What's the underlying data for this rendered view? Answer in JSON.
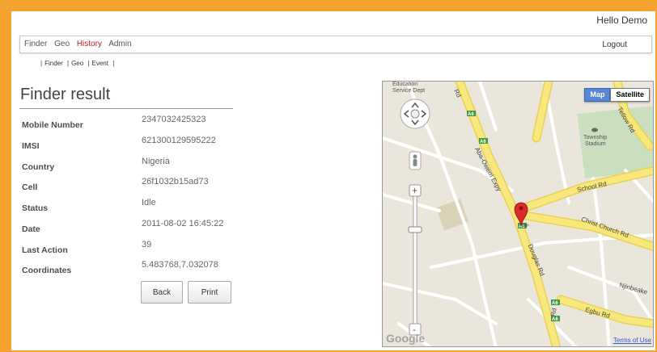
{
  "header": {
    "greeting": "Hello Demo"
  },
  "nav": {
    "items": [
      {
        "label": "Finder",
        "active": false
      },
      {
        "label": "Geo",
        "active": false
      },
      {
        "label": "History",
        "active": true
      },
      {
        "label": "Admin",
        "active": false
      }
    ],
    "logout": "Logout"
  },
  "subnav": {
    "items": [
      "Finder",
      "Geo",
      "Event"
    ]
  },
  "page": {
    "title": "Finder result"
  },
  "fields": [
    {
      "label": "Mobile Number",
      "value": "2347032425323"
    },
    {
      "label": "IMSI",
      "value": "621300129595222"
    },
    {
      "label": "Country",
      "value": "Nigeria"
    },
    {
      "label": "Cell",
      "value": "26f1032b15ad73"
    },
    {
      "label": "Status",
      "value": "Idle"
    },
    {
      "label": "Date",
      "value": "2011-08-02 16:45:22"
    },
    {
      "label": "Last Action",
      "value": "39"
    },
    {
      "label": "Coordinates",
      "value": "5.483768,7.032078"
    }
  ],
  "buttons": {
    "back": "Back",
    "print": "Print"
  },
  "map": {
    "type_map": "Map",
    "type_satellite": "Satellite",
    "place_labels": [
      "Education",
      "Service Dept",
      "Township",
      "Stadium"
    ],
    "roads": [
      "Aba-Owerri Expy",
      "School Rd",
      "Christ Church Rd",
      "Douglas Rd",
      "Egbu Rd",
      "Njinbeake",
      "Tetlow Rd",
      "Rd",
      "Rd"
    ],
    "shields": [
      "A6",
      "A6",
      "A6",
      "A6",
      "A6"
    ],
    "attribution": "Terms of Use",
    "logo": "Google",
    "colors": {
      "road_major": "#f7e77c",
      "road_minor": "#ffffff",
      "land": "#ebe6dc",
      "park": "#c9dfc0",
      "marker": "#d92b2b"
    }
  }
}
